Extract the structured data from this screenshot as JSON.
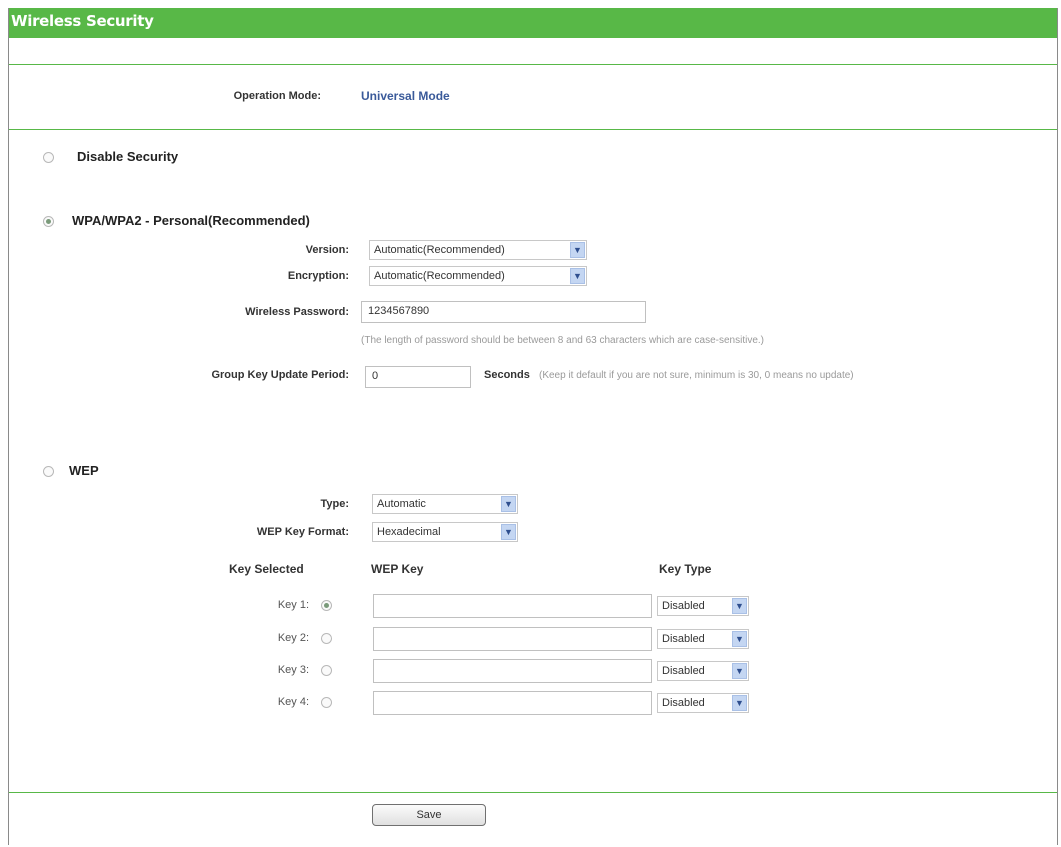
{
  "header": {
    "title": "Wireless Security"
  },
  "operation_mode": {
    "label": "Operation Mode:",
    "value": "Universal Mode"
  },
  "disable_security": {
    "label": "Disable Security"
  },
  "wpa": {
    "label": "WPA/WPA2 - Personal(Recommended)",
    "version_label": "Version:",
    "version_value": "Automatic(Recommended)",
    "encryption_label": "Encryption:",
    "encryption_value": "Automatic(Recommended)",
    "password_label": "Wireless Password:",
    "password_value": "1234567890",
    "password_hint": "(The length of password should be between 8 and 63 characters which are case-sensitive.)",
    "group_key_label": "Group Key Update Period:",
    "group_key_value": "0",
    "seconds_label": "Seconds",
    "group_key_hint": "(Keep it default if you are not sure, minimum is 30, 0 means no update)"
  },
  "wep": {
    "label": "WEP",
    "type_label": "Type:",
    "type_value": "Automatic",
    "format_label": "WEP Key Format:",
    "format_value": "Hexadecimal",
    "col_key_selected": "Key Selected",
    "col_wep_key": "WEP Key",
    "col_key_type": "Key Type",
    "keys": [
      {
        "label": "Key 1:",
        "value": "",
        "type": "Disabled"
      },
      {
        "label": "Key 2:",
        "value": "",
        "type": "Disabled"
      },
      {
        "label": "Key 3:",
        "value": "",
        "type": "Disabled"
      },
      {
        "label": "Key 4:",
        "value": "",
        "type": "Disabled"
      }
    ]
  },
  "footer": {
    "save_label": "Save"
  },
  "colors": {
    "accent": "#58b847",
    "mode_text": "#3a5a9a"
  }
}
